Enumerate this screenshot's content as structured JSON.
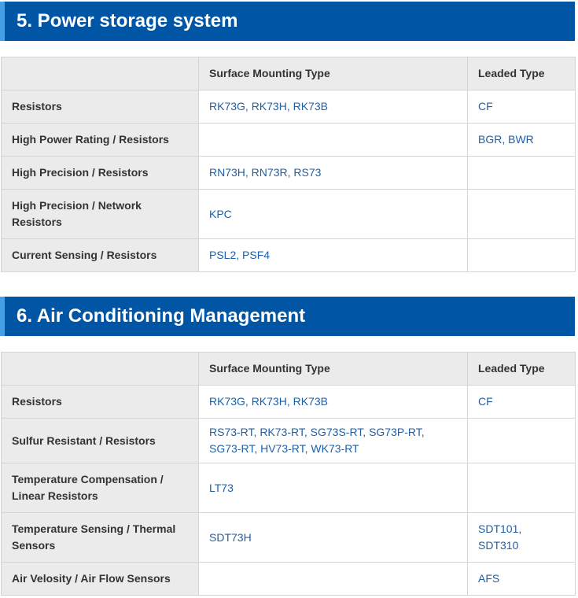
{
  "section5": {
    "title": "5. Power storage system",
    "headers": [
      "",
      "Surface Mounting Type",
      "Leaded Type"
    ],
    "rows": [
      {
        "label": "Resistors",
        "smt": "RK73G, RK73H, RK73B",
        "leaded": "CF"
      },
      {
        "label": "High Power Rating / Resistors",
        "smt": "",
        "leaded": "BGR, BWR"
      },
      {
        "label": "High Precision / Resistors",
        "smt": "RN73H, RN73R, RS73",
        "leaded": ""
      },
      {
        "label": "High Precision / Network Resistors",
        "smt": "KPC",
        "leaded": ""
      },
      {
        "label": "Current Sensing / Resistors",
        "smt": "PSL2, PSF4",
        "leaded": ""
      }
    ]
  },
  "section6": {
    "title": "6. Air Conditioning Management",
    "headers": [
      "",
      "Surface Mounting Type",
      "Leaded Type"
    ],
    "rows": [
      {
        "label": "Resistors",
        "smt": "RK73G, RK73H, RK73B",
        "leaded": "CF"
      },
      {
        "label": "Sulfur Resistant / Resistors",
        "smt": "RS73-RT, RK73-RT, SG73S-RT, SG73P-RT, SG73-RT, HV73-RT, WK73-RT",
        "leaded": ""
      },
      {
        "label": "Temperature Compensation / Linear Resistors",
        "smt": "LT73",
        "leaded": ""
      },
      {
        "label": "Temperature Sensing / Thermal Sensors",
        "smt": "SDT73H",
        "leaded": "SDT101, SDT310"
      },
      {
        "label": "Air Velosity / Air Flow Sensors",
        "smt": "",
        "leaded": "AFS"
      }
    ]
  }
}
